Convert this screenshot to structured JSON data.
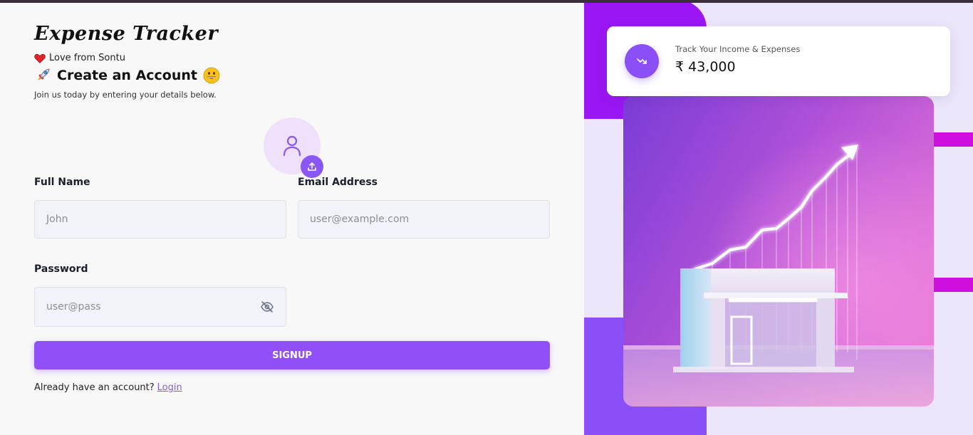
{
  "brand": {
    "title": "Expense Tracker",
    "love_text": "Love from Sontu"
  },
  "form": {
    "heading": "Create an Account",
    "subheading": "Join us today by entering your details below.",
    "full_name": {
      "label": "Full Name",
      "placeholder": "John"
    },
    "email": {
      "label": "Email Address",
      "placeholder": "user@example.com"
    },
    "password": {
      "label": "Password",
      "placeholder": "user@pass"
    },
    "signup_label": "SIGNUP",
    "already_text": "Already have an account?",
    "login_label": "Login"
  },
  "stat_card": {
    "label": "Track Your Income & Expenses",
    "value": "₹ 43,000"
  },
  "icons": {
    "heart": "heart-icon",
    "rocket": "rocket-icon",
    "smile": "smile-icon",
    "avatar": "user-icon",
    "upload": "upload-icon",
    "eye_off": "eye-off-icon",
    "trend": "trend-icon"
  },
  "colors": {
    "accent": "#8b57f2",
    "button": "#9150f7",
    "deco_purple": "#9a16f4",
    "deco_magenta": "#cf0fe0"
  }
}
